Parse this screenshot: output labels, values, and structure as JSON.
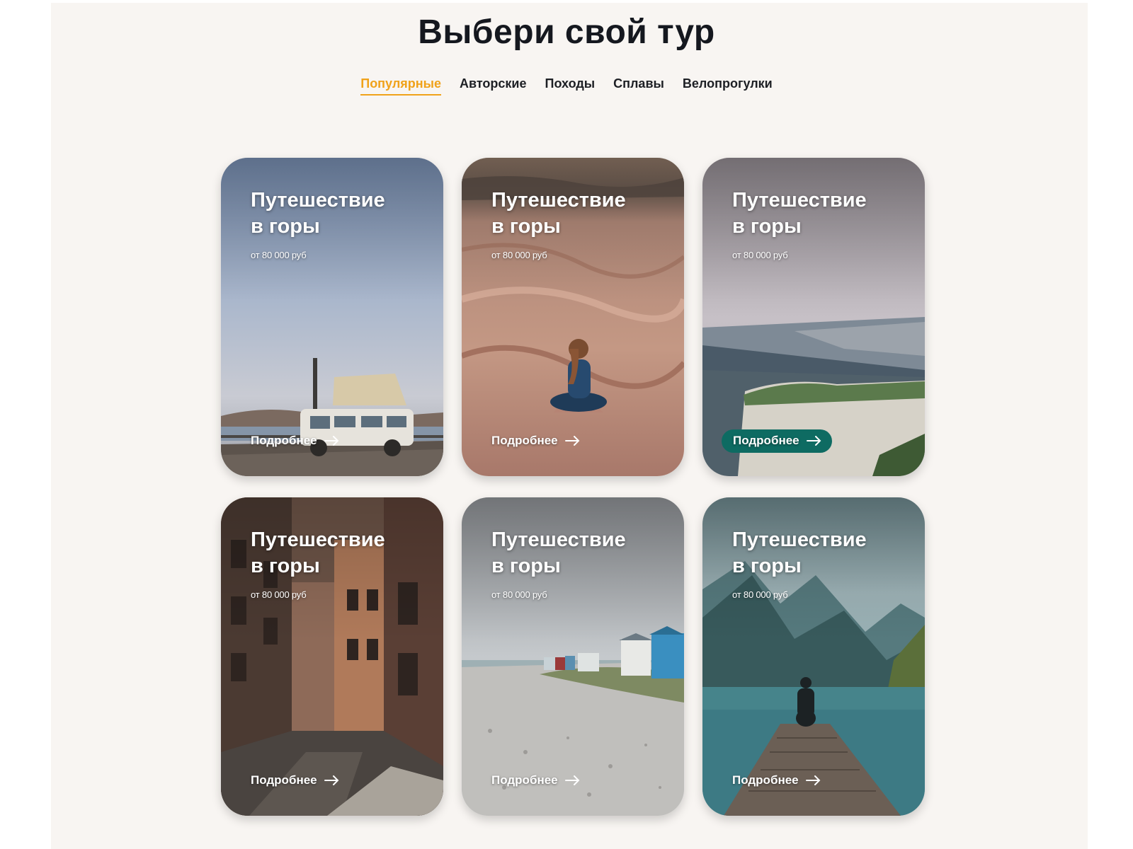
{
  "page": {
    "title": "Выбери свой тур"
  },
  "tabs": [
    {
      "label": "Популярные",
      "active": true
    },
    {
      "label": "Авторские",
      "active": false
    },
    {
      "label": "Походы",
      "active": false
    },
    {
      "label": "Сплавы",
      "active": false
    },
    {
      "label": "Велопрогулки",
      "active": false
    }
  ],
  "colors": {
    "accent": "#f0a21a",
    "button_highlight": "#0e6b62",
    "heading": "#15181f",
    "background": "#f8f5f2"
  },
  "cards": [
    {
      "title_line1": "Путешествие",
      "title_line2": "в горы",
      "price": "от 80 000 руб",
      "more": "Подробнее",
      "scene": "van-by-sea"
    },
    {
      "title_line1": "Путешествие",
      "title_line2": "в горы",
      "price": "от 80 000 руб",
      "more": "Подробнее",
      "scene": "desert-dunes"
    },
    {
      "title_line1": "Путешествие",
      "title_line2": "в горы",
      "price": "от 80 000 руб",
      "more": "Подробнее",
      "scene": "cliff-coast",
      "highlighted": true
    },
    {
      "title_line1": "Путешествие",
      "title_line2": "в горы",
      "price": "от 80 000 руб",
      "more": "Подробнее",
      "scene": "old-town-street"
    },
    {
      "title_line1": "Путешествие",
      "title_line2": "в горы",
      "price": "от 80 000 руб",
      "more": "Подробнее",
      "scene": "beach-huts"
    },
    {
      "title_line1": "Путешествие",
      "title_line2": "в горы",
      "price": "от 80 000 руб",
      "more": "Подробнее",
      "scene": "lake-pier"
    }
  ]
}
